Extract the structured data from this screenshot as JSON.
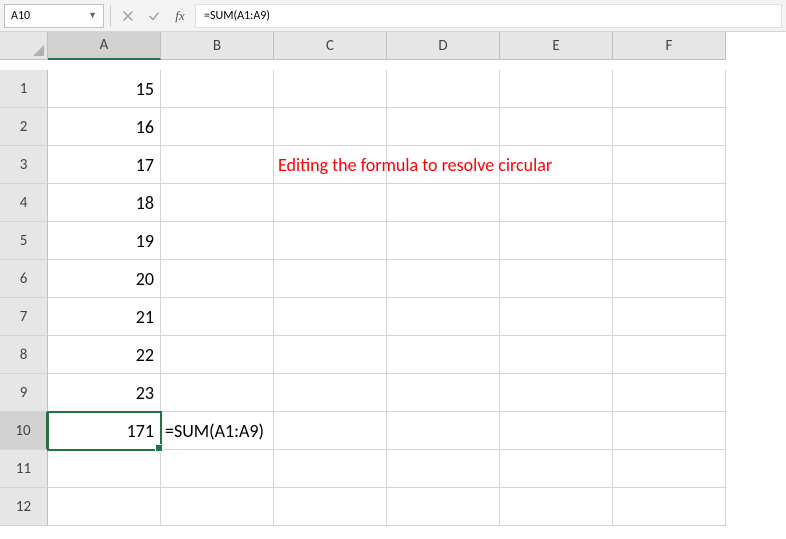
{
  "formulaBar": {
    "nameBox": "A10",
    "formula": "=SUM(A1:A9)"
  },
  "columns": [
    "A",
    "B",
    "C",
    "D",
    "E",
    "F"
  ],
  "rows": [
    "1",
    "2",
    "3",
    "4",
    "5",
    "6",
    "7",
    "8",
    "9",
    "10",
    "11",
    "12"
  ],
  "activeCell": "A10",
  "cells": {
    "A1": "15",
    "A2": "16",
    "A3": "17",
    "A4": "18",
    "A5": "19",
    "A6": "20",
    "A7": "21",
    "A8": "22",
    "A9": "23",
    "A10": "171",
    "B10": "=SUM(A1:A9)"
  },
  "annotation": "Editing the formula to resolve circular"
}
